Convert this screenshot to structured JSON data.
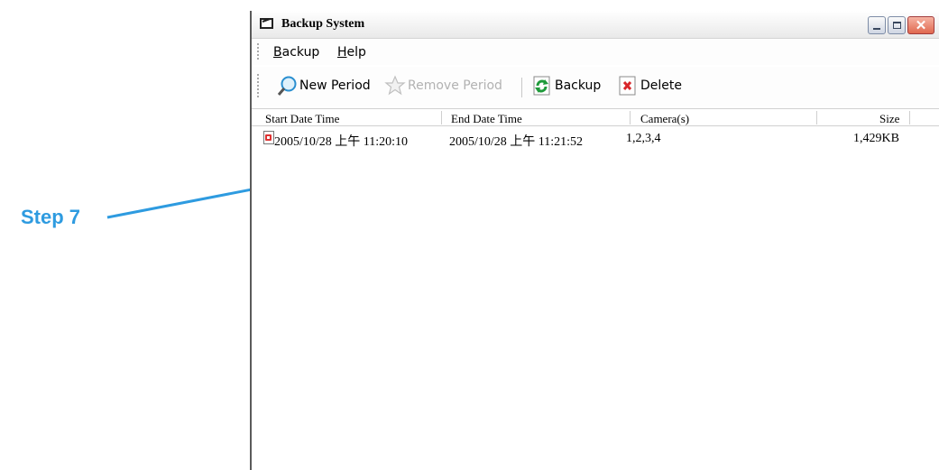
{
  "annotation": {
    "step_label": "Step 7"
  },
  "window": {
    "title": "Backup System",
    "controls": {
      "minimize_icon": "minimize-icon",
      "maximize_icon": "maximize-icon",
      "close_icon": "close-icon"
    }
  },
  "menu": [
    {
      "accel": "B",
      "rest": "ackup"
    },
    {
      "accel": "H",
      "rest": "elp"
    }
  ],
  "toolbar": {
    "new_period": "New Period",
    "remove_period": "Remove Period",
    "backup": "Backup",
    "delete": "Delete"
  },
  "table": {
    "columns": [
      "Start Date Time",
      "End Date Time",
      "Camera(s)",
      "Size"
    ],
    "rows": [
      {
        "start": "2005/10/28 上午 11:20:10",
        "end": "2005/10/28 上午 11:21:52",
        "cameras": "1,2,3,4",
        "size": "1,429KB"
      }
    ]
  },
  "colors": {
    "annotation": "#2e9be0",
    "close_button": "#e0684f"
  }
}
